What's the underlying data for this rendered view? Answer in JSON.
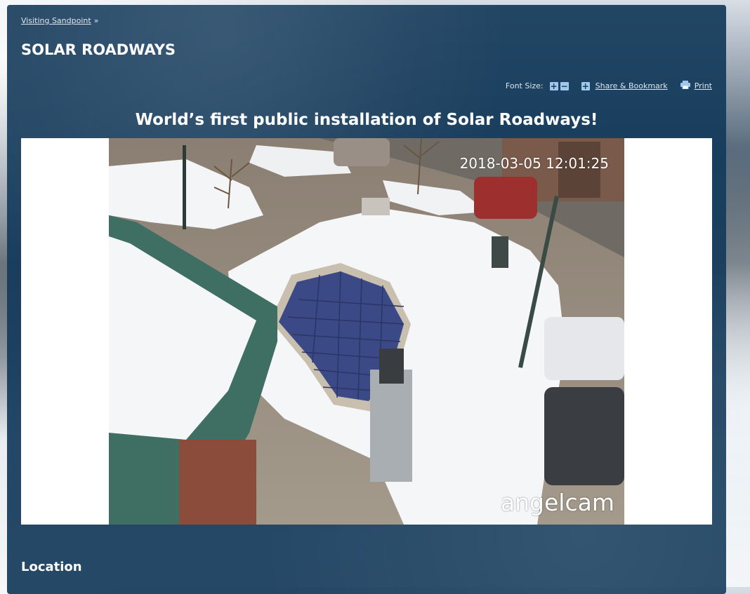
{
  "breadcrumb": {
    "link_label": "Visiting Sandpoint",
    "separator": "»"
  },
  "page": {
    "title": "SOLAR ROADWAYS"
  },
  "toolbar": {
    "font_size_label": "Font Size:",
    "increase_glyph": "+",
    "decrease_glyph": "−",
    "share_glyph": "+",
    "share_label": "Share & Bookmark",
    "print_label": "Print"
  },
  "content": {
    "headline": "World’s first public installation of Solar Roadways!",
    "webcam": {
      "timestamp": "2018-03-05 12:01:25",
      "watermark": "angelcam"
    },
    "location_heading": "Location"
  },
  "colors": {
    "panel": "#14395a",
    "tool_icon": "#9fc8ea",
    "text": "#ffffff"
  }
}
